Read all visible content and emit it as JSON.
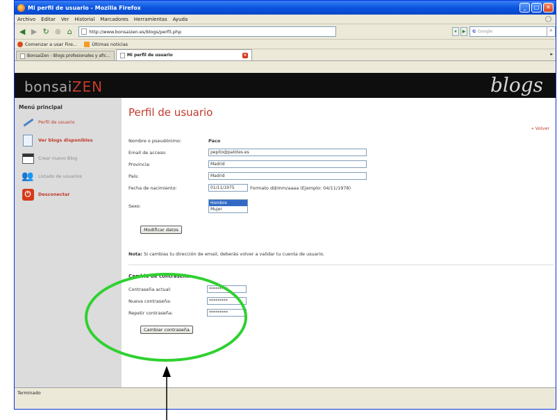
{
  "window": {
    "title": "Mi perfil de usuario - Mozilla Firefox",
    "controls": [
      "_",
      "□",
      "✕"
    ]
  },
  "menubar": {
    "items": [
      "Archivo",
      "Editar",
      "Ver",
      "Historial",
      "Marcadores",
      "Herramientas",
      "Ayuda"
    ]
  },
  "navbar": {
    "url": "http://www.bonsaizen.es/blogs/perfil.php",
    "search_placeholder": "Google",
    "search_engine": "G"
  },
  "bookmarks": {
    "items": [
      "Comenzar a usar Fire...",
      "Últimas noticias"
    ]
  },
  "tabs": {
    "items": [
      {
        "label": "BonsaiZen - Blogs profesionales y afic..."
      },
      {
        "label": "Mi perfil de usuario"
      }
    ]
  },
  "site": {
    "logo_left": "bonsai",
    "logo_right": "ZEN",
    "logo_blogs": "blogs"
  },
  "sidebar": {
    "title": "Menú principal",
    "items": [
      {
        "label": "Perfil de usuario",
        "icon": "pencil-icon"
      },
      {
        "label": "Ver blogs disponibles",
        "icon": "document-icon"
      },
      {
        "label": "Crear nuevo Blog",
        "icon": "window-icon"
      },
      {
        "label": "Listado de usuarios",
        "icon": "users-icon"
      },
      {
        "label": "Desconectar",
        "icon": "power-icon"
      }
    ]
  },
  "profile": {
    "title": "Perfil de usuario",
    "back_link": "« Volver",
    "fields": {
      "nickname": {
        "label": "Nombre o pseudónimo:",
        "value": "Paco"
      },
      "email": {
        "label": "Email de acceso:",
        "value": "pepito@palotes.es"
      },
      "province": {
        "label": "Provincia:",
        "value": "Madrid"
      },
      "country": {
        "label": "País:",
        "value": "Madrid"
      },
      "birthdate": {
        "label": "Fecha de nacimiento:",
        "value": "01/11/1975",
        "hint": "Formato dd/mm/aaaa (Ejemplo: 04/11/1978)"
      },
      "sex": {
        "label": "Sexo:",
        "options": [
          "Hombre",
          "Mujer"
        ],
        "selected": "Hombre"
      }
    },
    "modify_button": "Modificar datos",
    "note_bold": "Nota:",
    "note_text": " Si cambias tu dirección de email, deberás volver a validar tu cuenta de usuario."
  },
  "password": {
    "title": "Cambio de contraseña:",
    "current_label": "Contraseña actual:",
    "current_value": "*********",
    "new_label": "Nueva contraseña:",
    "new_value": "*********",
    "repeat_label": "Repetir contraseña:",
    "repeat_value": "*********",
    "button": "Cambiar contraseña"
  },
  "status": {
    "text": "Terminado"
  },
  "annotation": {
    "ellipse_color": "#2fd12f",
    "arrow_color": "#000000"
  }
}
